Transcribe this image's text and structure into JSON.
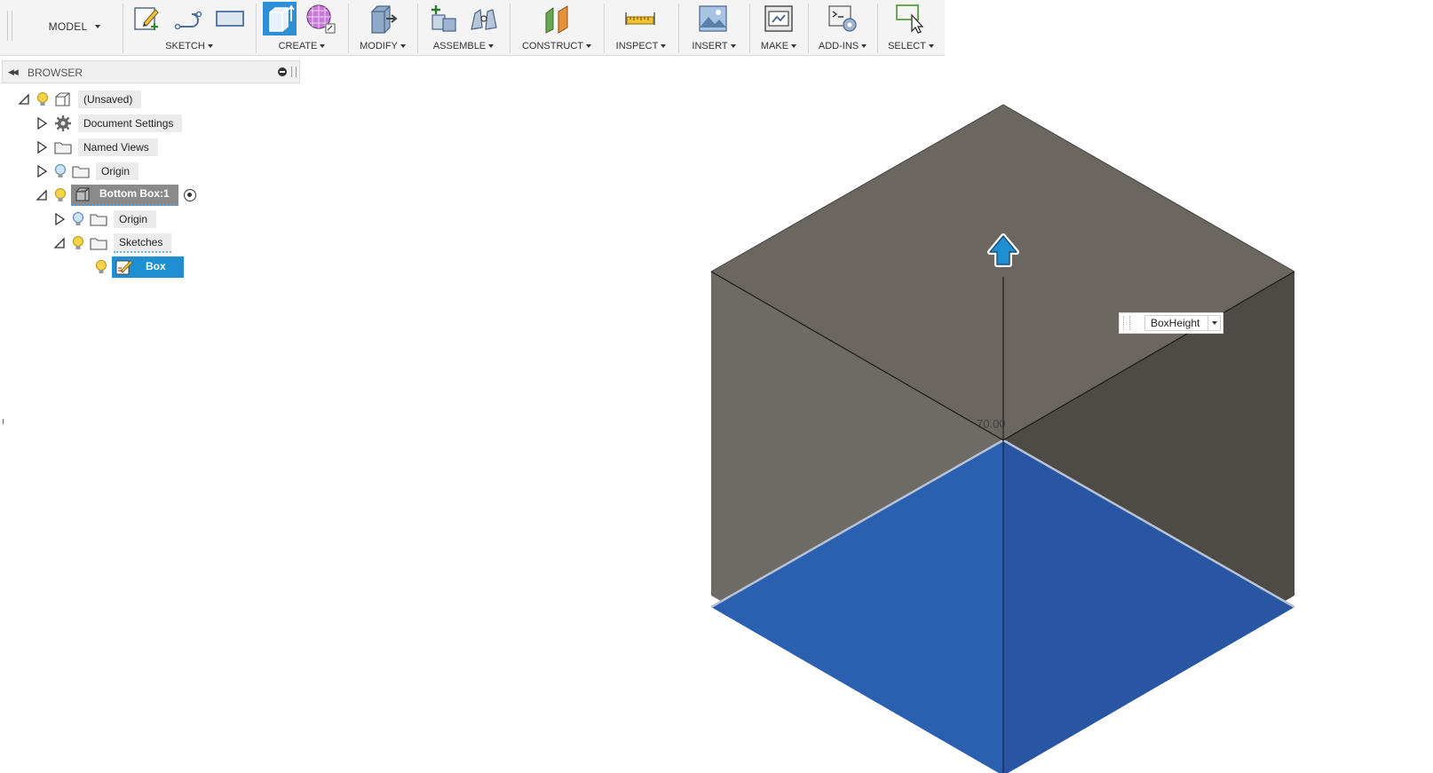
{
  "toolbar": {
    "workspace_label": "MODEL",
    "groups": {
      "sketch": "SKETCH",
      "create": "CREATE",
      "modify": "MODIFY",
      "assemble": "ASSEMBLE",
      "construct": "CONSTRUCT",
      "inspect": "INSPECT",
      "insert": "INSERT",
      "make": "MAKE",
      "addins": "ADD-INS",
      "select": "SELECT"
    }
  },
  "browser": {
    "title": "BROWSER",
    "items": [
      {
        "label": "(Unsaved)"
      },
      {
        "label": "Document Settings"
      },
      {
        "label": "Named Views"
      },
      {
        "label": "Origin"
      },
      {
        "label": "Bottom Box:1"
      },
      {
        "label": "Origin"
      },
      {
        "label": "Sketches"
      },
      {
        "label": "Box"
      }
    ]
  },
  "viewport": {
    "dimension_value": "70.00",
    "parameter_value": "BoxHeight"
  },
  "colors": {
    "accent": "#2e8fd6",
    "selected_face": "#2b5fb0",
    "body_top": "#6b6660",
    "body_left": "#6e6b66",
    "body_right": "#4e4b47"
  }
}
